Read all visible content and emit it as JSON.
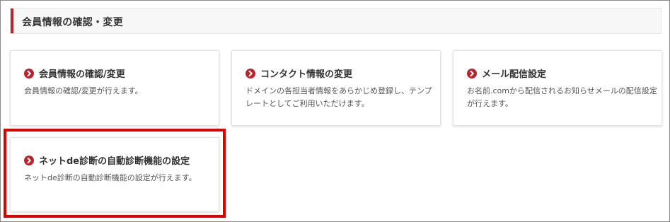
{
  "header": {
    "title": "会員情報の確認・変更"
  },
  "cards": [
    {
      "title": "会員情報の確認/変更",
      "description": "会員情報の確認/変更が行えます。"
    },
    {
      "title": "コンタクト情報の変更",
      "description": "ドメインの各担当者情報をあらかじめ登録し、テンプレートとしてご利用いただけます。"
    },
    {
      "title": "メール配信設定",
      "description": "お名前.comから配信されるお知らせメールの配信設定が行えます。"
    },
    {
      "title": "ネットde診断の自動診断機能の設定",
      "description": "ネットde診断の自動診断機能の設定が行えます。"
    }
  ],
  "icons": {
    "card_arrow": "chevron-right-circle-icon"
  },
  "colors": {
    "accent": "#b8262c",
    "highlight_border": "#e10000",
    "header_bg": "#f7f7f7"
  }
}
